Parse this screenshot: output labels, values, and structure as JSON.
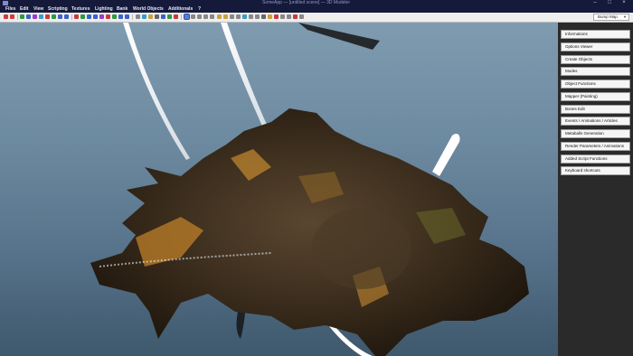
{
  "window": {
    "title": "SomeApp — [untitled scene] — 3D Modeler"
  },
  "menu": [
    {
      "label": "Files"
    },
    {
      "label": "Edit"
    },
    {
      "label": "View"
    },
    {
      "label": "Scripting"
    },
    {
      "label": "Textures"
    },
    {
      "label": "Lighting"
    },
    {
      "label": "Bank"
    },
    {
      "label": "World Objects"
    },
    {
      "label": "Additionals"
    },
    {
      "label": "?"
    }
  ],
  "toolbar": {
    "icons": [
      "undo-icon",
      "redo-icon",
      "move-icon",
      "rotate-icon",
      "scale-icon",
      "select-icon",
      "select-area-icon",
      "pointer-icon",
      "paint-icon",
      "fill-icon",
      "light-icon",
      "camera-icon",
      "render-icon",
      "sphere-icon",
      "cube-icon",
      "grid-icon",
      "view-icon",
      "zoom-icon",
      "settings-icon"
    ],
    "mode_select": "Bump Map"
  },
  "sidebar": {
    "items": [
      {
        "label": "Informations"
      },
      {
        "label": "Options Viewer"
      },
      {
        "label": "Create Objects"
      },
      {
        "label": "Modes"
      },
      {
        "label": "Object Functions"
      },
      {
        "label": "Mapper (Painting)"
      },
      {
        "label": "Bones Edit"
      },
      {
        "label": "Events / Animations / Articles"
      },
      {
        "label": "Metaballs Generation"
      },
      {
        "label": "Render Parameters / Animations"
      },
      {
        "label": "Added Script Functions"
      },
      {
        "label": "Keyboard shortcuts"
      }
    ]
  },
  "colors": {
    "menubar": "#151a3a",
    "toolbar": "#eeeeee",
    "sky_top": "#7f9bb0",
    "sky_bottom": "#3e586c",
    "sidebar": "#2a2a2a"
  }
}
